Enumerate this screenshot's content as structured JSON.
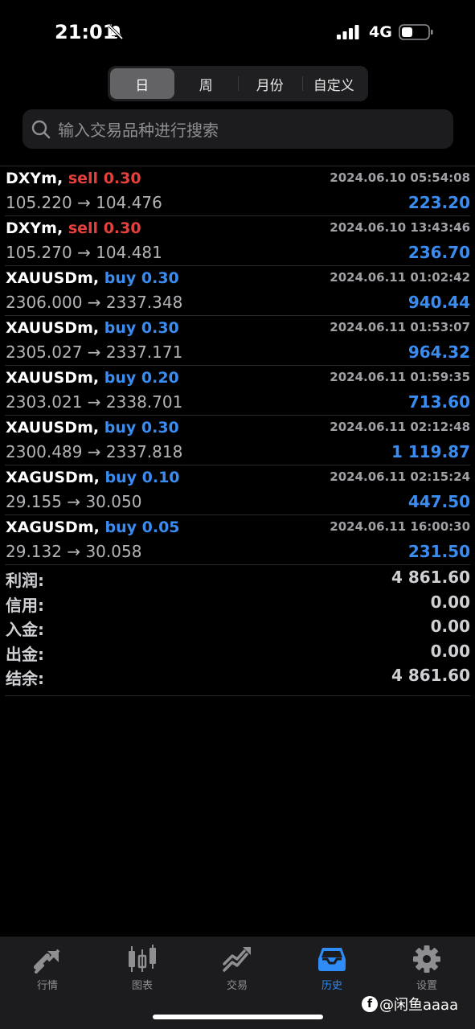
{
  "status": {
    "time": "21:01",
    "network": "4G"
  },
  "period_tabs": [
    {
      "label": "日",
      "active": true
    },
    {
      "label": "周",
      "active": false
    },
    {
      "label": "月份",
      "active": false
    },
    {
      "label": "自定义",
      "active": false
    }
  ],
  "search": {
    "placeholder": "输入交易品种进行搜索"
  },
  "deals": [
    {
      "symbol": "DXYm,",
      "side": "sell",
      "volume": "0.30",
      "time": "2024.06.10 05:54:08",
      "prices": "105.220 → 104.476",
      "profit": "223.20"
    },
    {
      "symbol": "DXYm,",
      "side": "sell",
      "volume": "0.30",
      "time": "2024.06.10 13:43:46",
      "prices": "105.270 → 104.481",
      "profit": "236.70"
    },
    {
      "symbol": "XAUUSDm,",
      "side": "buy",
      "volume": "0.30",
      "time": "2024.06.11 01:02:42",
      "prices": "2306.000 → 2337.348",
      "profit": "940.44"
    },
    {
      "symbol": "XAUUSDm,",
      "side": "buy",
      "volume": "0.30",
      "time": "2024.06.11 01:53:07",
      "prices": "2305.027 → 2337.171",
      "profit": "964.32"
    },
    {
      "symbol": "XAUUSDm,",
      "side": "buy",
      "volume": "0.20",
      "time": "2024.06.11 01:59:35",
      "prices": "2303.021 → 2338.701",
      "profit": "713.60"
    },
    {
      "symbol": "XAUUSDm,",
      "side": "buy",
      "volume": "0.30",
      "time": "2024.06.11 02:12:48",
      "prices": "2300.489 → 2337.818",
      "profit": "1 119.87"
    },
    {
      "symbol": "XAGUSDm,",
      "side": "buy",
      "volume": "0.10",
      "time": "2024.06.11 02:15:24",
      "prices": "29.155 → 30.050",
      "profit": "447.50"
    },
    {
      "symbol": "XAGUSDm,",
      "side": "buy",
      "volume": "0.05",
      "time": "2024.06.11 16:00:30",
      "prices": "29.132 → 30.058",
      "profit": "231.50"
    }
  ],
  "summary": [
    {
      "label": "利润:",
      "value": "4 861.60"
    },
    {
      "label": "信用:",
      "value": "0.00"
    },
    {
      "label": "入金:",
      "value": "0.00"
    },
    {
      "label": "出金:",
      "value": "0.00"
    },
    {
      "label": "结余:",
      "value": "4 861.60"
    }
  ],
  "tabs": [
    {
      "label": "行情",
      "icon": "quotes-icon",
      "active": false
    },
    {
      "label": "图表",
      "icon": "chart-icon",
      "active": false
    },
    {
      "label": "交易",
      "icon": "trade-icon",
      "active": false
    },
    {
      "label": "历史",
      "icon": "history-icon",
      "active": true
    },
    {
      "label": "设置",
      "icon": "settings-icon",
      "active": false
    }
  ],
  "watermark": {
    "text": "@闲鱼aaaa"
  },
  "colors": {
    "sell": "#e5403c",
    "buy": "#3a8cf0",
    "active_tab": "#2f8bf5"
  }
}
